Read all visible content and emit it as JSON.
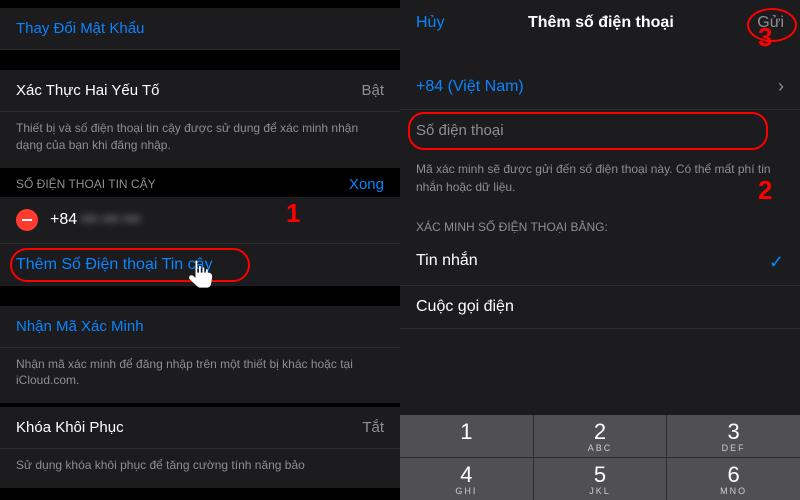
{
  "left": {
    "changePassword": "Thay Đổi Mật Khẩu",
    "twoFactor": {
      "label": "Xác Thực Hai Yếu Tố",
      "value": "Bật"
    },
    "twoFactorFooter": "Thiết bị và số điện thoại tin cậy được sử dụng để xác minh nhận dạng của bạn khi đăng nhập.",
    "trustedHeader": "SỐ ĐIỆN THOẠI TIN CẬY",
    "done": "Xong",
    "phonePrefix": "+84",
    "phoneHidden": "••• ••• •••",
    "addTrusted": "Thêm Số Điện thoại Tin cậy",
    "getCode": "Nhận Mã Xác Minh",
    "getCodeFooter": "Nhận mã xác minh để đăng nhập trên một thiết bị khác hoặc tại iCloud.com.",
    "recoveryKey": {
      "label": "Khóa Khôi Phục",
      "value": "Tắt"
    },
    "recoveryFooter": "Sử dụng khóa khôi phục để tăng cường tính năng bảo"
  },
  "right": {
    "cancel": "Hủy",
    "title": "Thêm số điện thoại",
    "send": "Gửi",
    "country": "+84 (Việt Nam)",
    "phonePlaceholder": "Số điện thoại",
    "info": "Mã xác minh sẽ được gửi đến số điện thoại này. Có thể mất phí tin nhắn hoặc dữ liệu.",
    "verifyHeader": "XÁC MINH SỐ ĐIỆN THOẠI BẰNG:",
    "sms": "Tin nhắn",
    "call": "Cuộc gọi điện"
  },
  "keypad": [
    {
      "num": "1",
      "let": ""
    },
    {
      "num": "2",
      "let": "ABC"
    },
    {
      "num": "3",
      "let": "DEF"
    },
    {
      "num": "4",
      "let": "GHI"
    },
    {
      "num": "5",
      "let": "JKL"
    },
    {
      "num": "6",
      "let": "MNO"
    }
  ],
  "markers": {
    "m1": "1",
    "m2": "2",
    "m3": "3"
  }
}
